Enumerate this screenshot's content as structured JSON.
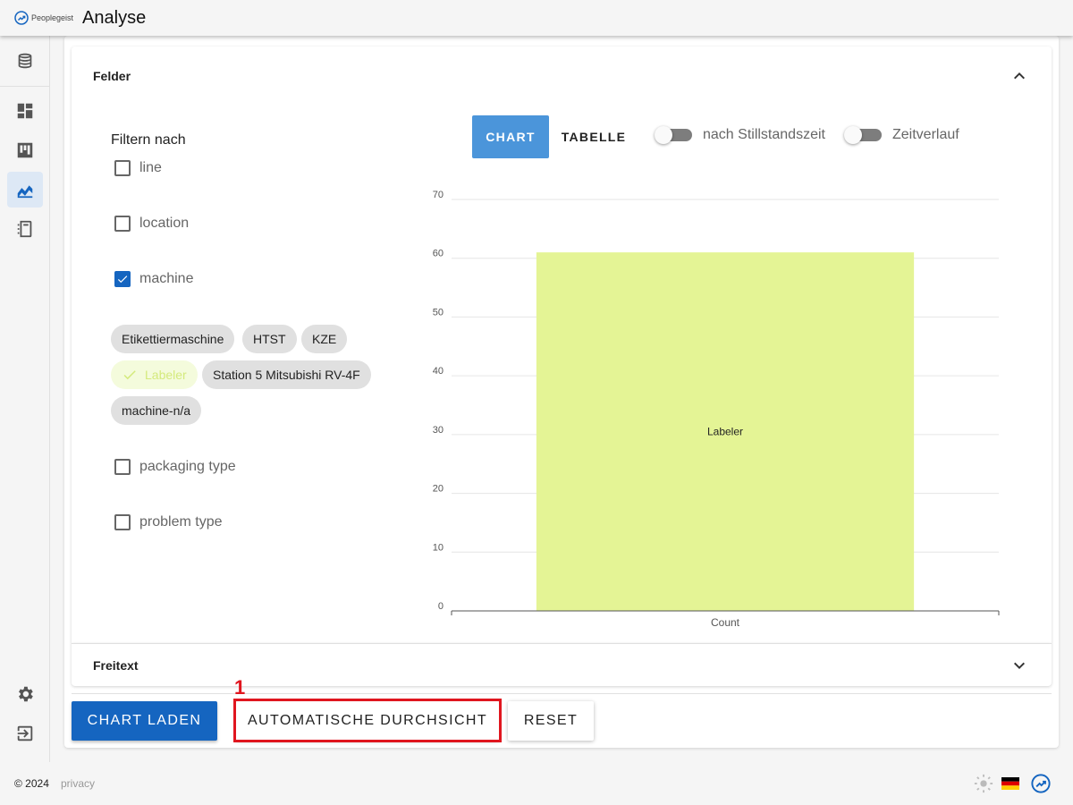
{
  "header": {
    "brand_name": "Peoplegeist",
    "title": "Analyse"
  },
  "sidebar": {
    "items": [
      {
        "name": "database-icon"
      },
      {
        "name": "dashboard-icon"
      },
      {
        "name": "kanban-icon"
      },
      {
        "name": "analytics-icon",
        "active": true
      },
      {
        "name": "notebook-icon"
      },
      {
        "name": "gear-icon"
      },
      {
        "name": "logout-icon"
      }
    ]
  },
  "panels": {
    "felder": {
      "title": "Felder",
      "expanded": true
    },
    "freitext": {
      "title": "Freitext",
      "expanded": false
    }
  },
  "filters": {
    "heading": "Filtern nach",
    "items": [
      {
        "label": "line",
        "checked": false
      },
      {
        "label": "location",
        "checked": false
      },
      {
        "label": "machine",
        "checked": true
      },
      {
        "label": "packaging type",
        "checked": false
      },
      {
        "label": "problem type",
        "checked": false
      }
    ],
    "machine_chips": [
      {
        "label": "Etikettiermaschine",
        "selected": false
      },
      {
        "label": "HTST",
        "selected": false
      },
      {
        "label": "KZE",
        "selected": false
      },
      {
        "label": "Labeler",
        "selected": true
      },
      {
        "label": "Station 5 Mitsubishi RV-4F",
        "selected": false
      },
      {
        "label": "machine-n/a",
        "selected": false
      }
    ]
  },
  "view_toggle": {
    "chart_label": "CHART",
    "table_label": "TABELLE",
    "active": "chart"
  },
  "switches": {
    "downtime": {
      "label": "nach Stillstandszeit",
      "on": false
    },
    "timeline": {
      "label": "Zeitverlauf",
      "on": false
    }
  },
  "chart_data": {
    "type": "bar",
    "categories": [
      "Count"
    ],
    "series": [
      {
        "name": "Labeler",
        "values": [
          61
        ],
        "color": "#e4f495"
      }
    ],
    "yticks": [
      0,
      10,
      20,
      30,
      40,
      50,
      60,
      70
    ],
    "ylim": [
      0,
      70
    ],
    "grid": true,
    "bar_label": "Labeler"
  },
  "actions": {
    "load_label": "Chart laden",
    "auto_label": "Automatische Durchsicht",
    "reset_label": "Reset",
    "marker": "1"
  },
  "footer": {
    "copyright": "© 2024",
    "privacy": "privacy"
  },
  "colors": {
    "primary": "#1565c0",
    "chart_toggle": "#4b95da",
    "highlight": "#e0161f",
    "bar": "#e4f495"
  }
}
